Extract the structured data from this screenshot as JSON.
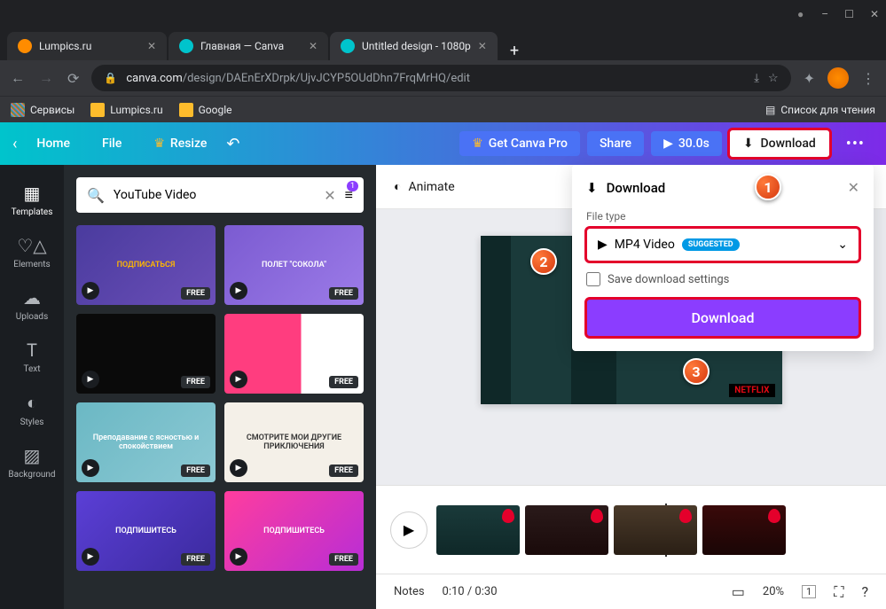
{
  "window": {
    "minimize": "–",
    "maximize": "☐",
    "close": "✕",
    "incognito": "●"
  },
  "tabs": [
    {
      "label": "Lumpics.ru",
      "favicon": "#ff8c00"
    },
    {
      "label": "Главная — Canva",
      "favicon": "#00c4cc"
    },
    {
      "label": "Untitled design - 1080p",
      "favicon": "#00c4cc",
      "active": true
    }
  ],
  "url": {
    "domain": "canva.com",
    "path": "/design/DAEnErXDrpk/UjvJCYP5OUdDhn7FrqMrHQ/edit"
  },
  "bookmarks": {
    "services": "Сервисы",
    "lumpics": "Lumpics.ru",
    "google": "Google",
    "readlist": "Список для чтения"
  },
  "header": {
    "home": "Home",
    "file": "File",
    "resize": "Resize",
    "pro": "Get Canva Pro",
    "share": "Share",
    "duration": "30.0s",
    "download": "Download"
  },
  "rail": {
    "templates": "Templates",
    "elements": "Elements",
    "uploads": "Uploads",
    "text": "Text",
    "styles": "Styles",
    "background": "Background"
  },
  "search": {
    "placeholder": "",
    "value": "YouTube Video",
    "badge": "1"
  },
  "templates_free": "FREE",
  "template_cards": [
    {
      "bg": "linear-gradient(135deg,#4a3b9e,#6b4fb8)",
      "txt": "ПОДПИСАТЬСЯ",
      "c": "#ffb700"
    },
    {
      "bg": "linear-gradient(135deg,#7b5bd1,#9c7be8)",
      "txt": "ПОЛЕТ \"СОКОЛА\"",
      "c": "#fff"
    },
    {
      "bg": "#0a0a0a",
      "txt": "",
      "c": "#fff"
    },
    {
      "bg": "linear-gradient(90deg,#ff3d7f 55%,#fff 55%)",
      "txt": "",
      "c": "#111"
    },
    {
      "bg": "linear-gradient(135deg,#6bb8c4,#8cc9d4)",
      "txt": "Преподавание с ясностью и спокойствием",
      "c": "#fff"
    },
    {
      "bg": "#f4f0e8",
      "txt": "СМОТРИТЕ МОИ ДРУГИЕ ПРИКЛЮЧЕНИЯ",
      "c": "#333"
    },
    {
      "bg": "linear-gradient(135deg,#5b3fd6,#3b2a9e)",
      "txt": "ПОДПИШИТЕСЬ",
      "c": "#fff"
    },
    {
      "bg": "linear-gradient(135deg,#ff3d9e,#b82dd6)",
      "txt": "ПОДПИШИТЕСЬ",
      "c": "#fff"
    }
  ],
  "animate": "Animate",
  "download_panel": {
    "title": "Download",
    "filetype_label": "File type",
    "filetype": "MP4 Video",
    "suggested": "SUGGESTED",
    "save": "Save download settings",
    "action": "Download"
  },
  "preview": {
    "netflix": "NETFLIX"
  },
  "frames": [
    {
      "bg": "linear-gradient(#1a3a3a,#0f2828)"
    },
    {
      "bg": "linear-gradient(#2a1a1a,#1a0a0a)"
    },
    {
      "bg": "linear-gradient(#4a3a2a,#2a1f15)"
    },
    {
      "bg": "linear-gradient(#3a0a0a,#1a0505)"
    }
  ],
  "footer": {
    "notes": "Notes",
    "time": "0:10 / 0:30",
    "zoom": "20%",
    "page": "1"
  }
}
